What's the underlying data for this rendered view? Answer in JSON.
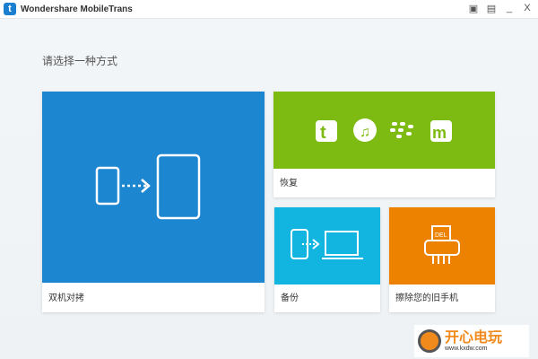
{
  "window": {
    "title": "Wondershare MobileTrans",
    "logo_letter": "t",
    "controls": [
      "feedback-icon",
      "register-icon",
      "minimize",
      "close"
    ],
    "minimize": "_",
    "close": "X"
  },
  "prompt": "请选择一种方式",
  "tiles": {
    "transfer": {
      "label": "双机对拷",
      "color": "#1d86d0"
    },
    "restore": {
      "label": "恢复",
      "color": "#7dbb12"
    },
    "backup": {
      "label": "备份",
      "color": "#12b5e0"
    },
    "erase": {
      "label": "擦除您的旧手机",
      "color": "#ec8200",
      "icon_text": "DEL"
    }
  },
  "watermark": {
    "title": "开心电玩",
    "url": "www.kxdw.com"
  }
}
